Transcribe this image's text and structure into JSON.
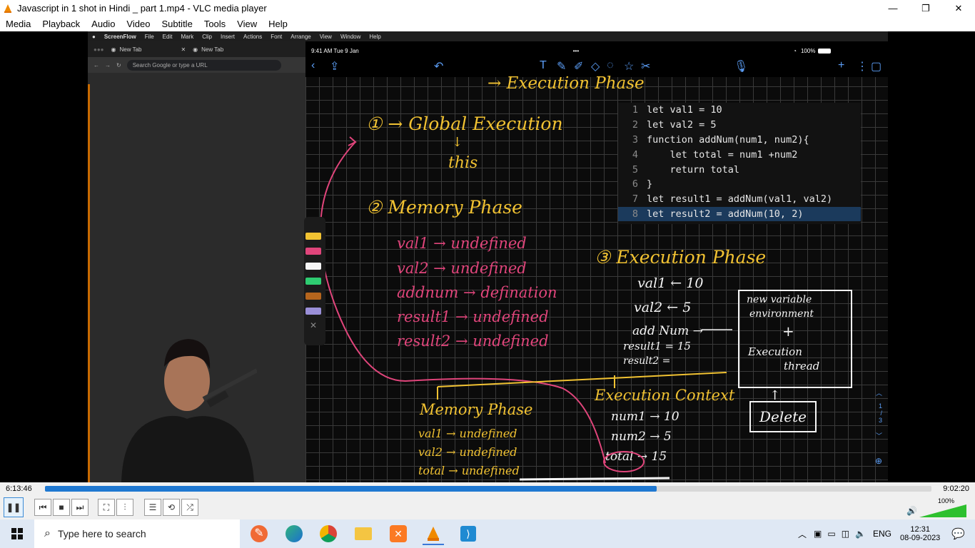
{
  "window": {
    "title": "Javascript in 1 shot in Hindi _ part 1.mp4 - VLC media player",
    "minimize": "—",
    "maximize": "❐",
    "close": "✕"
  },
  "menu": [
    "Media",
    "Playback",
    "Audio",
    "Video",
    "Subtitle",
    "Tools",
    "View",
    "Help"
  ],
  "mac_menubar": [
    "ScreenFlow",
    "File",
    "Edit",
    "Mark",
    "Clip",
    "Insert",
    "Actions",
    "Font",
    "Arrange",
    "View",
    "Window",
    "Help"
  ],
  "browser": {
    "tabs": [
      "New Tab",
      "New Tab"
    ],
    "url_placeholder": "Search Google or type a URL"
  },
  "ipad": {
    "time": "9:41 AM  Tue 9 Jan",
    "battery": "100%",
    "page_indicator": [
      "1",
      "/",
      "3"
    ]
  },
  "code": [
    {
      "n": "1",
      "text": "let val1 = 10"
    },
    {
      "n": "2",
      "text": "let val2 = 5"
    },
    {
      "n": "3",
      "text": "function addNum(num1, num2){"
    },
    {
      "n": "4",
      "text": "    let total = num1 +num2"
    },
    {
      "n": "5",
      "text": "    return total"
    },
    {
      "n": "6",
      "text": "}"
    },
    {
      "n": "7",
      "text": "let result1 = addNum(val1, val2)"
    },
    {
      "n": "8",
      "text": "let result2 = addNum(10, 2)"
    }
  ],
  "notes": {
    "heading": "→ Execution Phase",
    "global": "① → Global Execution",
    "this": "this",
    "memory_phase": "② Memory Phase",
    "mem_lines": [
      "val1 → undefined",
      "val2 → undefined",
      "addnum → defination",
      "result1 → undefined",
      "result2 → undefined"
    ],
    "exec_phase": "③ Execution Phase",
    "exec_lines": [
      "val1 ← 10",
      "val2 ← 5",
      "add Num →",
      "result1 = 15",
      "result2 ="
    ],
    "box_lines": [
      "new variable",
      "environment",
      "+",
      "Execution",
      "thread"
    ],
    "delete": "Delete",
    "memory_phase2": "Memory Phase",
    "mem2_lines": [
      "val1 → undefined",
      "val2 → undefined",
      "total → undefined"
    ],
    "exec_context": "Execution Context",
    "ctx_lines": [
      "num1 → 10",
      "num2 → 5",
      "total → 15"
    ]
  },
  "player": {
    "current_time": "6:13:46",
    "total_time": "9:02:20",
    "progress": 0.69,
    "volume": "100%"
  },
  "taskbar": {
    "search_placeholder": "Type here to search",
    "lang": "ENG",
    "time": "12:31",
    "date": "08-09-2023"
  }
}
